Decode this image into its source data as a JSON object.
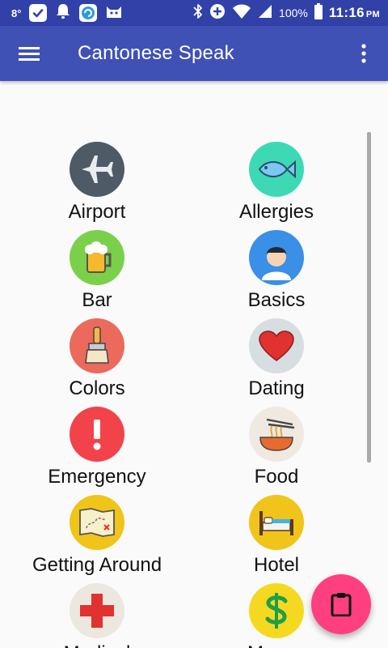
{
  "status_bar": {
    "temperature": "8°",
    "battery": "100%",
    "time": "11:16",
    "ampm": "PM",
    "icons": [
      "check-icon",
      "bell-icon",
      "app-icon",
      "cat-icon",
      "bluetooth-icon",
      "data-saver-icon",
      "wifi-icon",
      "signal-icon",
      "battery-icon"
    ]
  },
  "app_bar": {
    "title": "Cantonese Speak",
    "menu_icon": "hamburger-menu-icon",
    "overflow_icon": "more-vert-icon",
    "color": "#3f51b5"
  },
  "categories": [
    {
      "label": "Airport",
      "icon": "airplane-icon",
      "color": "#4e5a66"
    },
    {
      "label": "Allergies",
      "icon": "fish-icon",
      "color": "#3dd9b5"
    },
    {
      "label": "Bar",
      "icon": "beer-mug-icon",
      "color": "#7bd04a"
    },
    {
      "label": "Basics",
      "icon": "person-icon",
      "color": "#3a8fe6"
    },
    {
      "label": "Colors",
      "icon": "paintbrush-icon",
      "color": "#ec6a5c"
    },
    {
      "label": "Dating",
      "icon": "heart-icon",
      "color": "#d6dee2"
    },
    {
      "label": "Emergency",
      "icon": "exclamation-icon",
      "color": "#f2434a"
    },
    {
      "label": "Food",
      "icon": "noodle-bowl-icon",
      "color": "#efe9e0"
    },
    {
      "label": "Getting Around",
      "icon": "map-icon",
      "color": "#f0c419"
    },
    {
      "label": "Hotel",
      "icon": "bed-icon",
      "color": "#f0c419"
    },
    {
      "label": "Medical",
      "icon": "medical-cross-icon",
      "color": "#ece7df"
    },
    {
      "label": "Money",
      "icon": "dollar-icon",
      "color": "#f5d920"
    }
  ],
  "fab": {
    "icon": "clipboard-icon",
    "color": "#ff3f7f"
  }
}
